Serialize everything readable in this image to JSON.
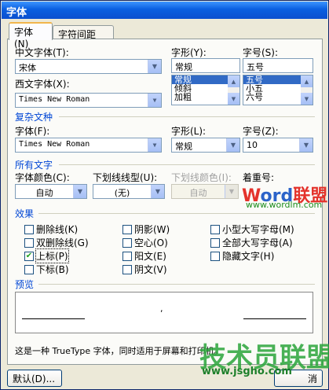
{
  "window": {
    "title": "字体"
  },
  "tabs": [
    {
      "label": "字体(N)"
    },
    {
      "label": "字符间距(R)"
    }
  ],
  "font_section": {
    "chinese_font_label": "中文字体(T):",
    "chinese_font_value": "宋体",
    "western_font_label": "西文字体(X):",
    "western_font_value": "Times New Roman",
    "style_label": "字形(Y):",
    "style_value": "常规",
    "style_options": [
      "常规",
      "倾斜",
      "加粗"
    ],
    "size_label": "字号(S):",
    "size_value": "五号",
    "size_options": [
      "五号",
      "小五",
      "六号"
    ]
  },
  "complex_section": {
    "title": "复杂文种",
    "font_label": "字体(F):",
    "font_value": "Times New Roman",
    "style_label": "字形(L):",
    "style_value": "常规",
    "size_label": "字号(Z):",
    "size_value": "10"
  },
  "all_text_section": {
    "title": "所有文字",
    "font_color_label": "字体颜色(C):",
    "font_color_value": "自动",
    "underline_type_label": "下划线线型(U):",
    "underline_type_value": "(无)",
    "underline_color_label": "下划线颜色(I):",
    "underline_color_value": "自动",
    "emphasis_label": "着重号:"
  },
  "effects": {
    "title": "效果",
    "items": [
      {
        "label": "删除线(K)",
        "checked": false
      },
      {
        "label": "双删除线(G)",
        "checked": false
      },
      {
        "label": "上标(P)",
        "checked": true
      },
      {
        "label": "下标(B)",
        "checked": false
      },
      {
        "label": "阴影(W)",
        "checked": false
      },
      {
        "label": "空心(O)",
        "checked": false
      },
      {
        "label": "阳文(E)",
        "checked": false
      },
      {
        "label": "阴文(V)",
        "checked": false
      },
      {
        "label": "小型大写字母(M)",
        "checked": false
      },
      {
        "label": "全部大写字母(A)",
        "checked": false
      },
      {
        "label": "隐藏文字(H)",
        "checked": false
      }
    ]
  },
  "preview": {
    "title": "预览",
    "sample_char": ",",
    "description": "这是一种 TrueType 字体，同时适用于屏幕和打印机。"
  },
  "buttons": {
    "default_label": "默认(D)...",
    "cancel_label": "消"
  },
  "watermarks": {
    "top_brand_w": "W",
    "top_brand_ord": "ord",
    "top_brand_cn": "联盟",
    "top_url": "www.wordlm.com",
    "bottom_brand": "技术员联盟",
    "bottom_url": "www.jsgho.com"
  },
  "colors": {
    "title_bar": "#0a5fe0",
    "section_title": "#0046d5",
    "selection": "#316ac5",
    "check_mark": "#21a121"
  }
}
